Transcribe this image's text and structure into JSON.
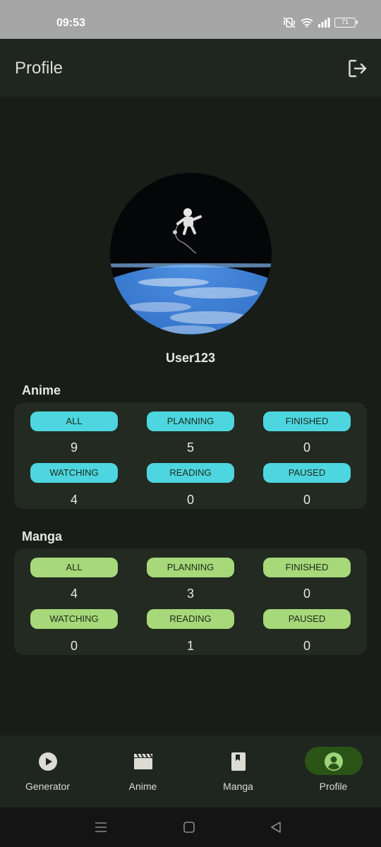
{
  "status_bar": {
    "time": "09:53",
    "battery": "71"
  },
  "app_bar": {
    "title": "Profile",
    "logout_icon": "logout-icon"
  },
  "profile": {
    "username": "User123",
    "avatar_icon": "astronaut-earth-avatar"
  },
  "anime": {
    "title": "Anime",
    "stats": [
      {
        "label": "ALL",
        "value": "9"
      },
      {
        "label": "PLANNING",
        "value": "5"
      },
      {
        "label": "FINISHED",
        "value": "0"
      },
      {
        "label": "WATCHING",
        "value": "4"
      },
      {
        "label": "READING",
        "value": "0"
      },
      {
        "label": "PAUSED",
        "value": "0"
      }
    ],
    "chip_color": "#4dd6df"
  },
  "manga": {
    "title": "Manga",
    "stats": [
      {
        "label": "ALL",
        "value": "4"
      },
      {
        "label": "PLANNING",
        "value": "3"
      },
      {
        "label": "FINISHED",
        "value": "0"
      },
      {
        "label": "WATCHING",
        "value": "0"
      },
      {
        "label": "READING",
        "value": "1"
      },
      {
        "label": "PAUSED",
        "value": "0"
      }
    ],
    "chip_color": "#a7d879"
  },
  "nav": {
    "items": [
      {
        "label": "Generator",
        "icon": "play-circle-icon"
      },
      {
        "label": "Anime",
        "icon": "clapperboard-icon"
      },
      {
        "label": "Manga",
        "icon": "book-icon"
      },
      {
        "label": "Profile",
        "icon": "account-circle-icon",
        "active": true
      }
    ],
    "active_color": "#2a5416"
  }
}
